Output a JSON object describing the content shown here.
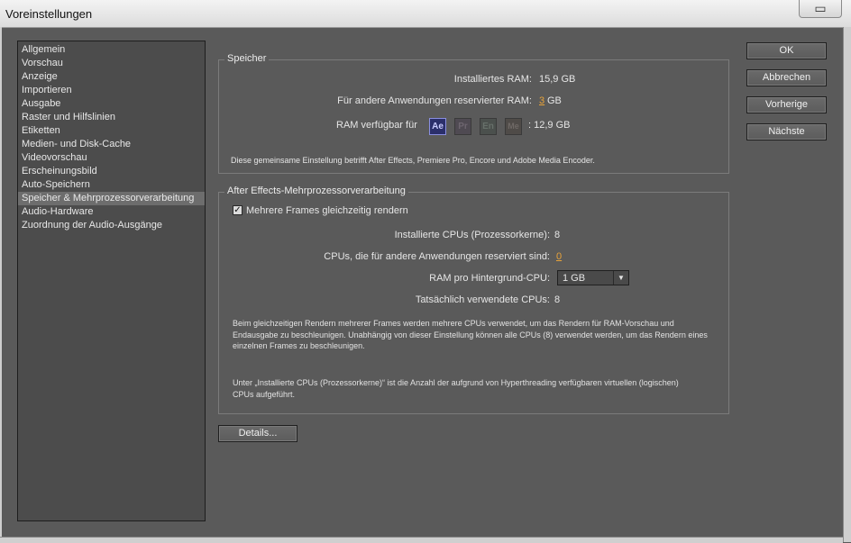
{
  "window": {
    "title": "Voreinstellungen",
    "close_symbol": "▭"
  },
  "sidebar": {
    "items": [
      {
        "label": "Allgemein"
      },
      {
        "label": "Vorschau"
      },
      {
        "label": "Anzeige"
      },
      {
        "label": "Importieren"
      },
      {
        "label": "Ausgabe"
      },
      {
        "label": "Raster und Hilfslinien"
      },
      {
        "label": "Etiketten"
      },
      {
        "label": "Medien- und Disk-Cache"
      },
      {
        "label": "Videovorschau"
      },
      {
        "label": "Erscheinungsbild"
      },
      {
        "label": "Auto-Speichern"
      },
      {
        "label": "Speicher & Mehrprozessorverarbeitung"
      },
      {
        "label": "Audio-Hardware"
      },
      {
        "label": "Zuordnung der Audio-Ausgänge"
      }
    ],
    "selected_index": 11
  },
  "memory": {
    "title": "Speicher",
    "installed_label": "Installiertes RAM:",
    "installed_value": "15,9 GB",
    "reserved_label": "Für andere Anwendungen reservierter RAM:",
    "reserved_value": "3",
    "reserved_unit": "GB",
    "available_label": "RAM verfügbar für",
    "apps": [
      {
        "icon": "after-effects-icon",
        "abbr": "Ae"
      },
      {
        "icon": "premiere-pro-icon",
        "abbr": "Pr"
      },
      {
        "icon": "encore-icon",
        "abbr": "En"
      },
      {
        "icon": "media-encoder-icon",
        "abbr": "Me"
      }
    ],
    "available_value": ": 12,9 GB",
    "note": "Diese gemeinsame Einstellung betrifft After Effects, Premiere Pro, Encore und Adobe Media Encoder."
  },
  "mp": {
    "title": "After Effects-Mehrprozessorverarbeitung",
    "checkbox_label": "Mehrere Frames gleichzeitig rendern",
    "checkbox_checked": true,
    "check_mark": "✓",
    "installed_cpus_label": "Installierte CPUs (Prozessorkerne):",
    "installed_cpus_value": "8",
    "reserved_cpus_label": "CPUs, die für andere Anwendungen reserviert sind:",
    "reserved_cpus_value": "0",
    "ram_per_cpu_label": "RAM pro Hintergrund-CPU:",
    "ram_per_cpu_value": "1 GB",
    "dropdown_arrow": "▼",
    "actual_cpus_label": "Tatsächlich verwendete CPUs:",
    "actual_cpus_value": "8",
    "para1": "Beim gleichzeitigen Rendern mehrerer Frames werden mehrere CPUs verwendet, um das Rendern für RAM-Vorschau und Endausgabe zu beschleunigen. Unabhängig von dieser Einstellung können alle CPUs (8) verwendet werden, um das Rendern eines einzelnen Frames zu beschleunigen.",
    "para2": "Unter „Installierte CPUs (Prozessorkerne)“ ist die Anzahl der aufgrund von Hyperthreading verfügbaren virtuellen (logischen) CPUs aufgeführt."
  },
  "buttons": {
    "details": "Details...",
    "ok": "OK",
    "cancel": "Abbrechen",
    "previous": "Vorherige",
    "next": "Nächste"
  },
  "colors": {
    "background": "#5a5a5a",
    "accent_value": "#e8a33a"
  }
}
